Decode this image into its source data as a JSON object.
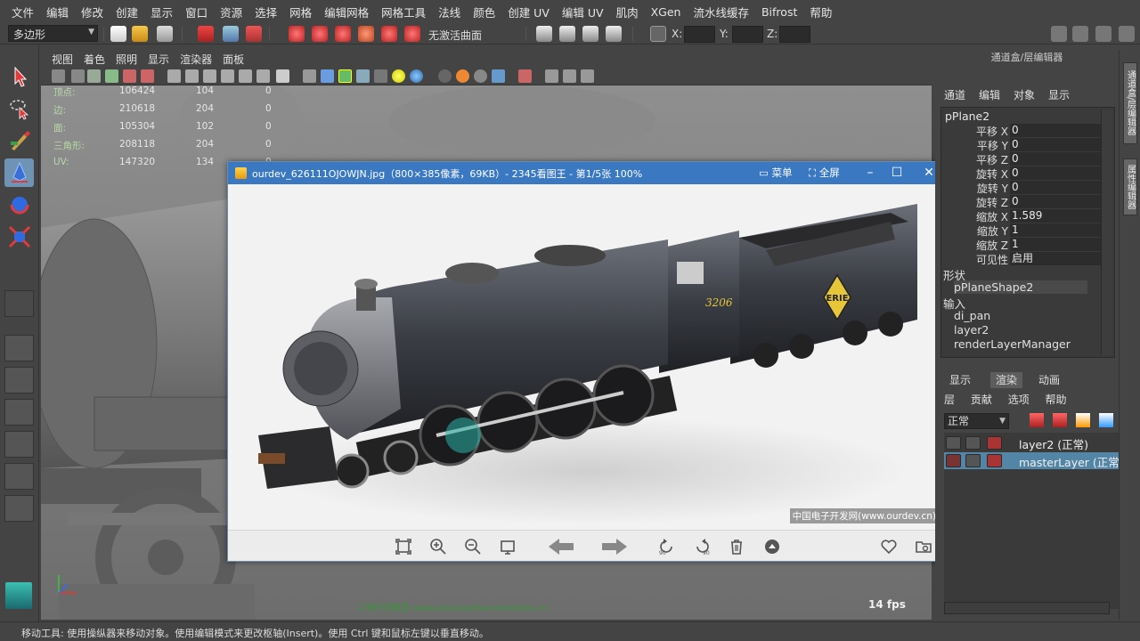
{
  "menubar": [
    "文件",
    "编辑",
    "修改",
    "创建",
    "显示",
    "窗口",
    "资源",
    "选择",
    "网格",
    "编辑网格",
    "网格工具",
    "法线",
    "颜色",
    "创建 UV",
    "编辑 UV",
    "肌肉",
    "XGen",
    "流水线缓存",
    "Bifrost",
    "帮助"
  ],
  "statusline": {
    "mode": "多边形",
    "nocurve_label": "无激活曲面",
    "x_label": "X:",
    "y_label": "Y:",
    "z_label": "Z:"
  },
  "viewport": {
    "menu": [
      "视图",
      "着色",
      "照明",
      "显示",
      "渲染器",
      "面板"
    ],
    "hud": [
      {
        "label": "顶点:",
        "v1": "106424",
        "v2": "104",
        "v3": "0"
      },
      {
        "label": "边:",
        "v1": "210618",
        "v2": "204",
        "v3": "0"
      },
      {
        "label": "面:",
        "v1": "105304",
        "v2": "102",
        "v3": "0"
      },
      {
        "label": "三角形:",
        "v1": "208118",
        "v2": "204",
        "v3": "0"
      },
      {
        "label": "UV:",
        "v1": "147320",
        "v2": "134",
        "v3": "0"
      }
    ],
    "fps": "14 fps",
    "watermark": "三维手游模型  www.aboutsoftwaremodels.cn",
    "colors": {
      "viewport_bg": "#8a8a8a",
      "model": "#7a7a7a"
    }
  },
  "image_viewer": {
    "title": "ourdev_626111OJOWJN.jpg（800×385像素，69KB）- 2345看图王 - 第1/5张 100%",
    "menu_label": "菜单",
    "fullscreen_label": "全屏",
    "minimize": "–",
    "maximize": "☐",
    "close": "✕",
    "locomotive_number": "3206",
    "tender_logo": "ERIE",
    "watermark": "中国电子开发网(www.ourdev.cn)",
    "toolbar_icons": [
      "fit-icon",
      "zoom-in-icon",
      "zoom-out-icon",
      "actual-size-icon",
      "prev-icon",
      "next-icon",
      "rotate-left-icon",
      "rotate-right-icon",
      "delete-icon",
      "up-icon",
      "favorite-icon",
      "folder-icon"
    ],
    "rotate_left_badge": "90",
    "rotate_right_badge": "90",
    "colors": {
      "title_bar": "#3b78c2"
    }
  },
  "channel_box": {
    "header": "通道盒/层编辑器",
    "menu": [
      "通道",
      "编辑",
      "对象",
      "显示"
    ],
    "object": "pPlane2",
    "attributes": [
      {
        "name": "平移 X",
        "value": "0"
      },
      {
        "name": "平移 Y",
        "value": "0"
      },
      {
        "name": "平移 Z",
        "value": "0"
      },
      {
        "name": "旋转 X",
        "value": "0"
      },
      {
        "name": "旋转 Y",
        "value": "0"
      },
      {
        "name": "旋转 Z",
        "value": "0"
      },
      {
        "name": "缩放 X",
        "value": "1.589"
      },
      {
        "name": "缩放 Y",
        "value": "1"
      },
      {
        "name": "缩放 Z",
        "value": "1"
      },
      {
        "name": "可见性",
        "value": "启用"
      }
    ],
    "shapes_header": "形状",
    "shape": "pPlaneShape2",
    "inputs_header": "输入",
    "inputs": [
      "di_pan",
      "layer2",
      "renderLayerManager"
    ]
  },
  "layer_editor": {
    "tabs": [
      "显示",
      "渲染",
      "动画"
    ],
    "active_tab": "渲染",
    "menu": [
      "层",
      "贡献",
      "选项",
      "帮助"
    ],
    "mode": "正常",
    "layers": [
      {
        "name": "layer2 (正常)",
        "selected": false
      },
      {
        "name": "masterLayer (正常",
        "selected": true
      }
    ]
  },
  "side_strip": [
    "通道盒/层编辑器",
    "属性编辑器"
  ],
  "helpline": "移动工具: 使用操纵器来移动对象。使用编辑模式来更改枢轴(Insert)。使用 Ctrl 键和鼠标左键以垂直移动。"
}
